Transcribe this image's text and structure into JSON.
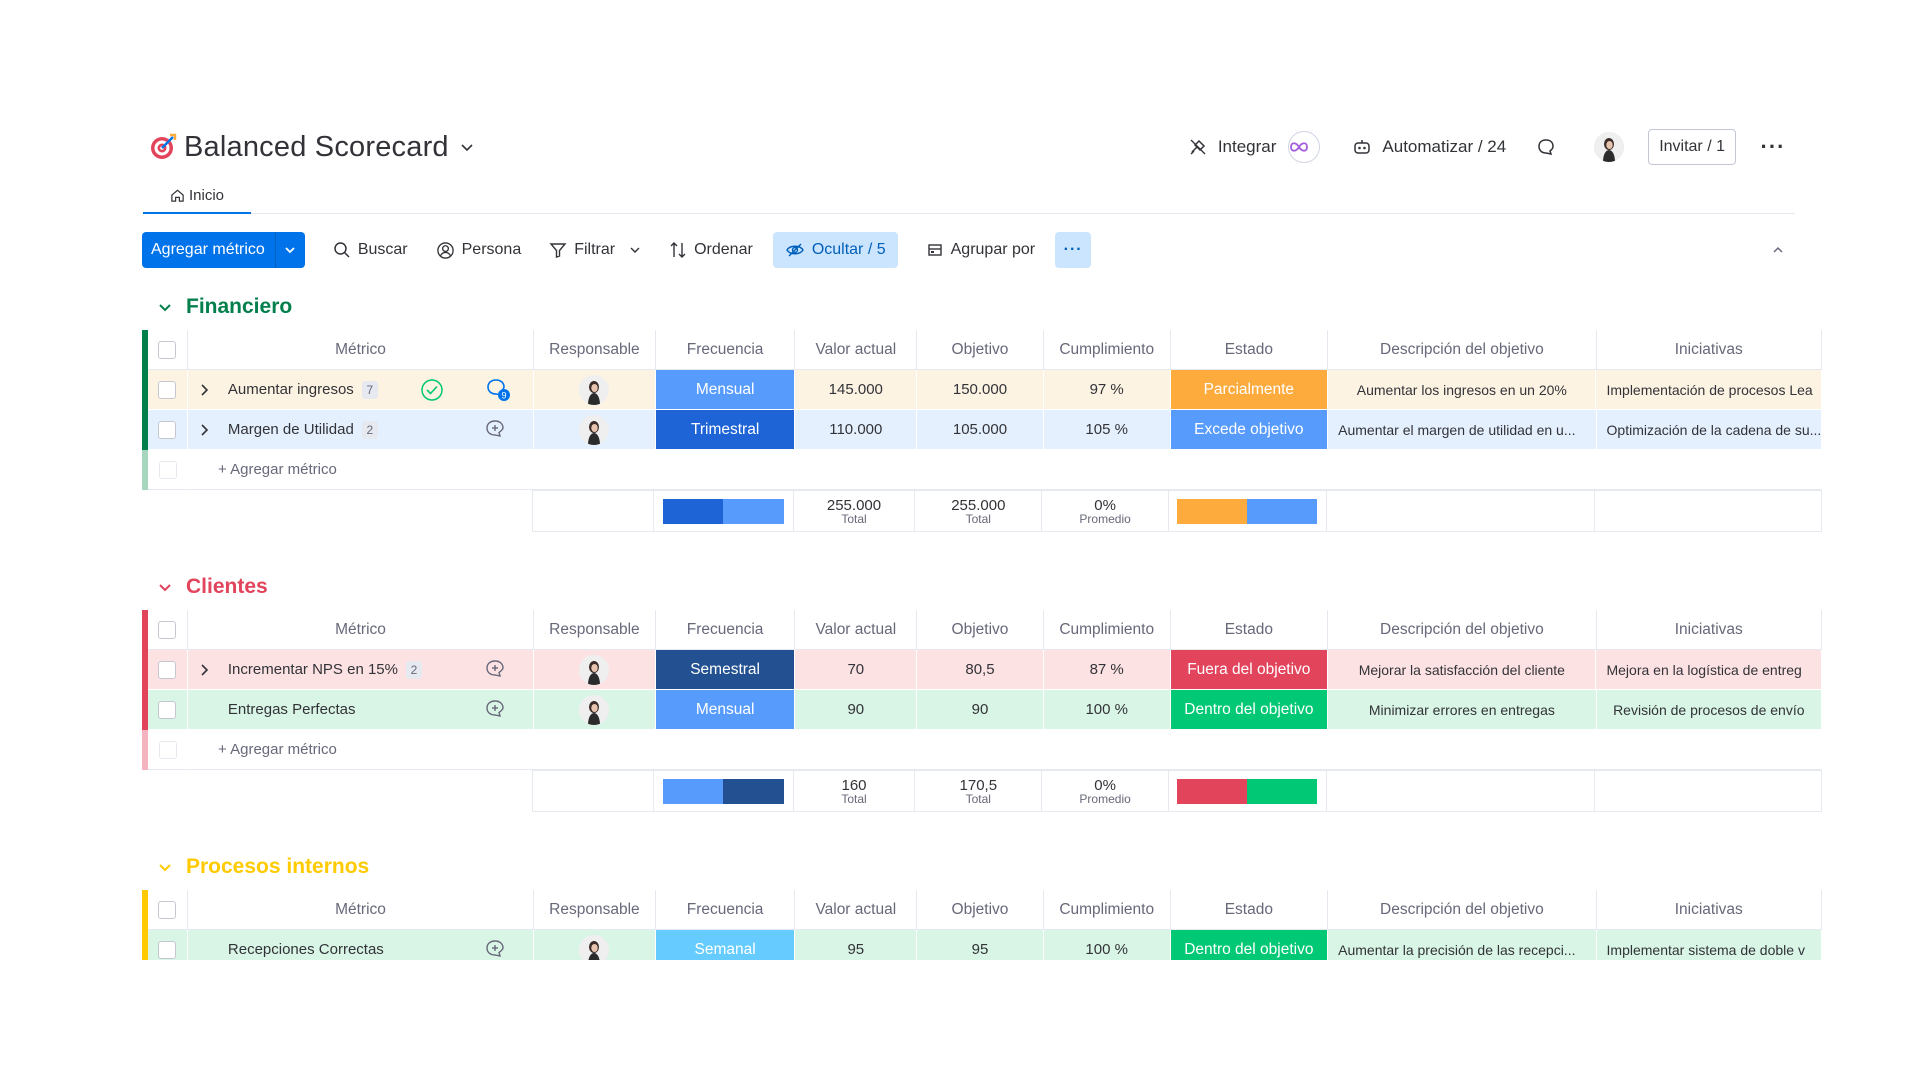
{
  "header": {
    "title": "Balanced Scorecard",
    "integrate_label": "Integrar",
    "automate_label": "Automatizar / 24",
    "invite_label": "Invitar / 1"
  },
  "tabs": [
    {
      "label": "Inicio"
    }
  ],
  "toolbar": {
    "add_label": "Agregar métrico",
    "search_label": "Buscar",
    "person_label": "Persona",
    "filter_label": "Filtrar",
    "sort_label": "Ordenar",
    "hide_label": "Ocultar / 5",
    "group_label": "Agrupar por"
  },
  "columns": [
    "Métrico",
    "Responsable",
    "Frecuencia",
    "Valor actual",
    "Objetivo",
    "Cumplimiento",
    "Estado",
    "Descripción del objetivo",
    "Iniciativas"
  ],
  "add_row_label": "+ Agregar métrico",
  "summary_labels": {
    "total": "Total",
    "average": "Promedio"
  },
  "colors": {
    "primary": "#0073ea",
    "financiero": "#037f4c",
    "clientes": "#e2445c",
    "procesos": "#ffcb00",
    "mensual": "#579bfc",
    "trimestral": "#1e64d6",
    "semestral": "#225091",
    "semanal": "#66ccff",
    "parcialmente": "#fdab3d",
    "excede": "#579bfc",
    "fuera": "#e2445c",
    "dentro": "#00c875"
  },
  "groups": [
    {
      "name": "Financiero",
      "color": "#037f4c",
      "rows": [
        {
          "metric": "Aumentar ingresos",
          "subitems": "7",
          "responsible": "person-avatar",
          "frequency": "Mensual",
          "current": "145.000",
          "target": "150.000",
          "compliance": "97 %",
          "status": "Parcialmente",
          "description": "Aumentar los ingresos en un 20%",
          "initiatives": "Implementación de procesos Lea"
        },
        {
          "metric": "Margen de Utilidad",
          "subitems": "2",
          "responsible": "person-avatar",
          "frequency": "Trimestral",
          "current": "110.000",
          "target": "105.000",
          "compliance": "105 %",
          "status": "Excede objetivo",
          "description": "Aumentar el margen de utilidad en u...",
          "initiatives": "Optimización de la cadena de su..."
        }
      ],
      "summary": {
        "frequency_split": [
          0.5,
          0.5
        ],
        "current_total": "255.000",
        "target_total": "255.000",
        "compliance_avg": "0%",
        "status_split": [
          0.5,
          0.5
        ]
      }
    },
    {
      "name": "Clientes",
      "color": "#e2445c",
      "rows": [
        {
          "metric": "Incrementar NPS en 15%",
          "subitems": "2",
          "responsible": "person-avatar",
          "frequency": "Semestral",
          "current": "70",
          "target": "80,5",
          "compliance": "87 %",
          "status": "Fuera del objetivo",
          "description": "Mejorar la satisfacción del cliente",
          "initiatives": "Mejora en la logística de entreg"
        },
        {
          "metric": "Entregas Perfectas",
          "subitems": "",
          "responsible": "person-avatar",
          "frequency": "Mensual",
          "current": "90",
          "target": "90",
          "compliance": "100 %",
          "status": "Dentro del objetivo",
          "description": "Minimizar errores en entregas",
          "initiatives": "Revisión de procesos de envío"
        }
      ],
      "summary": {
        "frequency_split": [
          0.5,
          0.5
        ],
        "current_total": "160",
        "target_total": "170,5",
        "compliance_avg": "0%",
        "status_split": [
          0.5,
          0.5
        ]
      }
    },
    {
      "name": "Procesos internos",
      "color": "#ffcb00",
      "rows": [
        {
          "metric": "Recepciones Correctas",
          "subitems": "",
          "responsible": "person-avatar",
          "frequency": "Semanal",
          "current": "95",
          "target": "95",
          "compliance": "100 %",
          "status": "Dentro del objetivo",
          "description": "Aumentar la precisión de las recepci...",
          "initiatives": "Implementar sistema de doble v"
        }
      ]
    }
  ]
}
